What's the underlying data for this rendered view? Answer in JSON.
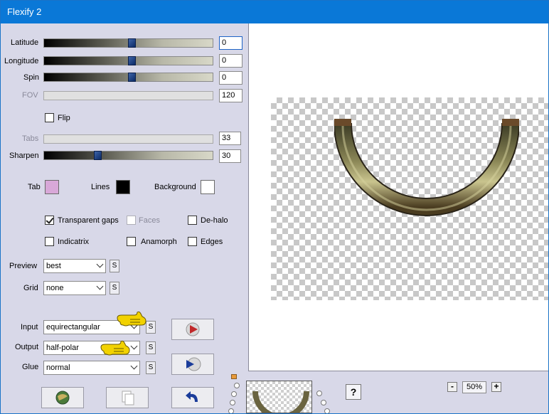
{
  "window": {
    "title": "Flexify 2"
  },
  "sliders": {
    "latitude": {
      "label": "Latitude",
      "value": "0",
      "level": 0.5
    },
    "longitude": {
      "label": "Longitude",
      "value": "0",
      "level": 0.5
    },
    "spin": {
      "label": "Spin",
      "value": "0",
      "level": 0.5
    },
    "fov": {
      "label": "FOV",
      "value": "120",
      "enabled": false
    },
    "tabs": {
      "label": "Tabs",
      "value": "33",
      "enabled": false
    },
    "sharpen": {
      "label": "Sharpen",
      "value": "30",
      "level": 0.3
    }
  },
  "flip": {
    "label": "Flip",
    "checked": false
  },
  "colors": {
    "tab": {
      "label": "Tab",
      "color": "#d8a8d8"
    },
    "lines": {
      "label": "Lines",
      "color": "#000000"
    },
    "background": {
      "label": "Background",
      "color": "#ffffff"
    }
  },
  "options": {
    "transparent_gaps": {
      "label": "Transparent gaps",
      "checked": true
    },
    "faces": {
      "label": "Faces",
      "checked": false,
      "enabled": false
    },
    "de_halo": {
      "label": "De-halo",
      "checked": false
    },
    "indicatrix": {
      "label": "Indicatrix",
      "checked": false
    },
    "anamorph": {
      "label": "Anamorph",
      "checked": false
    },
    "edges": {
      "label": "Edges",
      "checked": false
    }
  },
  "dropdowns": {
    "preview": {
      "label": "Preview",
      "value": "best"
    },
    "grid": {
      "label": "Grid",
      "value": "none"
    },
    "input": {
      "label": "Input",
      "value": "equirectangular"
    },
    "output": {
      "label": "Output",
      "value": "half-polar"
    },
    "glue": {
      "label": "Glue",
      "value": "normal"
    }
  },
  "s_button_label": "S",
  "zoom": {
    "minus": "-",
    "value": "50%",
    "plus": "+"
  },
  "help_label": "?",
  "accent_colors": {
    "title_bar": "#0a78d7",
    "slider_thumb": "#1a3c80",
    "hand_icon": "#f2d200"
  },
  "icons": [
    "pointing-hand-icon",
    "play-icon",
    "forward-play-icon",
    "globe-icon",
    "copy-icon",
    "undo-icon",
    "help-icon"
  ]
}
